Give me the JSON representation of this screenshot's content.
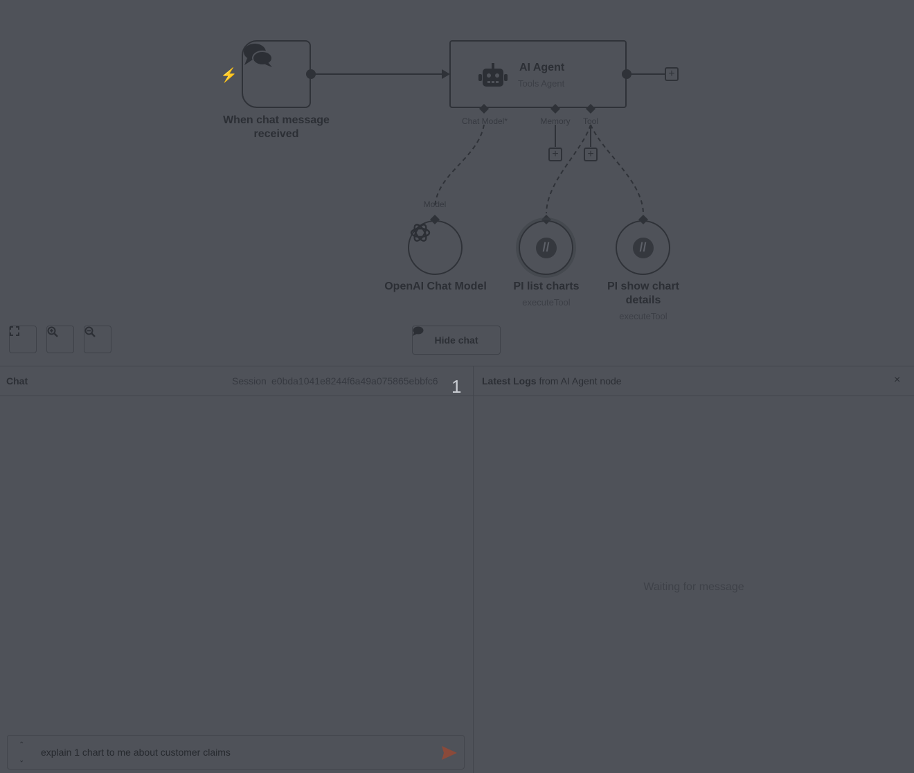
{
  "canvas": {
    "trigger_node": {
      "label": "When chat message received"
    },
    "agent_node": {
      "title": "AI Agent",
      "subtitle": "Tools Agent",
      "ports": {
        "chat_model": "Chat Model*",
        "memory": "Memory",
        "tool": "Tool"
      }
    },
    "model_port_label": "Model",
    "sub_nodes": [
      {
        "label": "OpenAI Chat Model",
        "subtitle": ""
      },
      {
        "label": "PI list charts",
        "subtitle": "executeTool"
      },
      {
        "label": "PI show chart details",
        "subtitle": "executeTool"
      }
    ],
    "controls": {
      "fit_icon": "fit-view-icon",
      "zoom_in_icon": "zoom-in-icon",
      "zoom_out_icon": "zoom-out-icon"
    },
    "hide_chat_label": "Hide chat"
  },
  "chat": {
    "title": "Chat",
    "session_label": "Session",
    "session_id": "e0bda1041e8244f6a49a075865ebbfc6",
    "badge": "1",
    "input_value": "explain 1 chart to me about customer claims"
  },
  "logs": {
    "title_bold": "Latest Logs",
    "title_rest": "from AI Agent node",
    "close": "×",
    "empty_message": "Waiting for message"
  },
  "colors": {
    "overlay_bg": "#4f5259",
    "accent": "#8b4a3a"
  }
}
